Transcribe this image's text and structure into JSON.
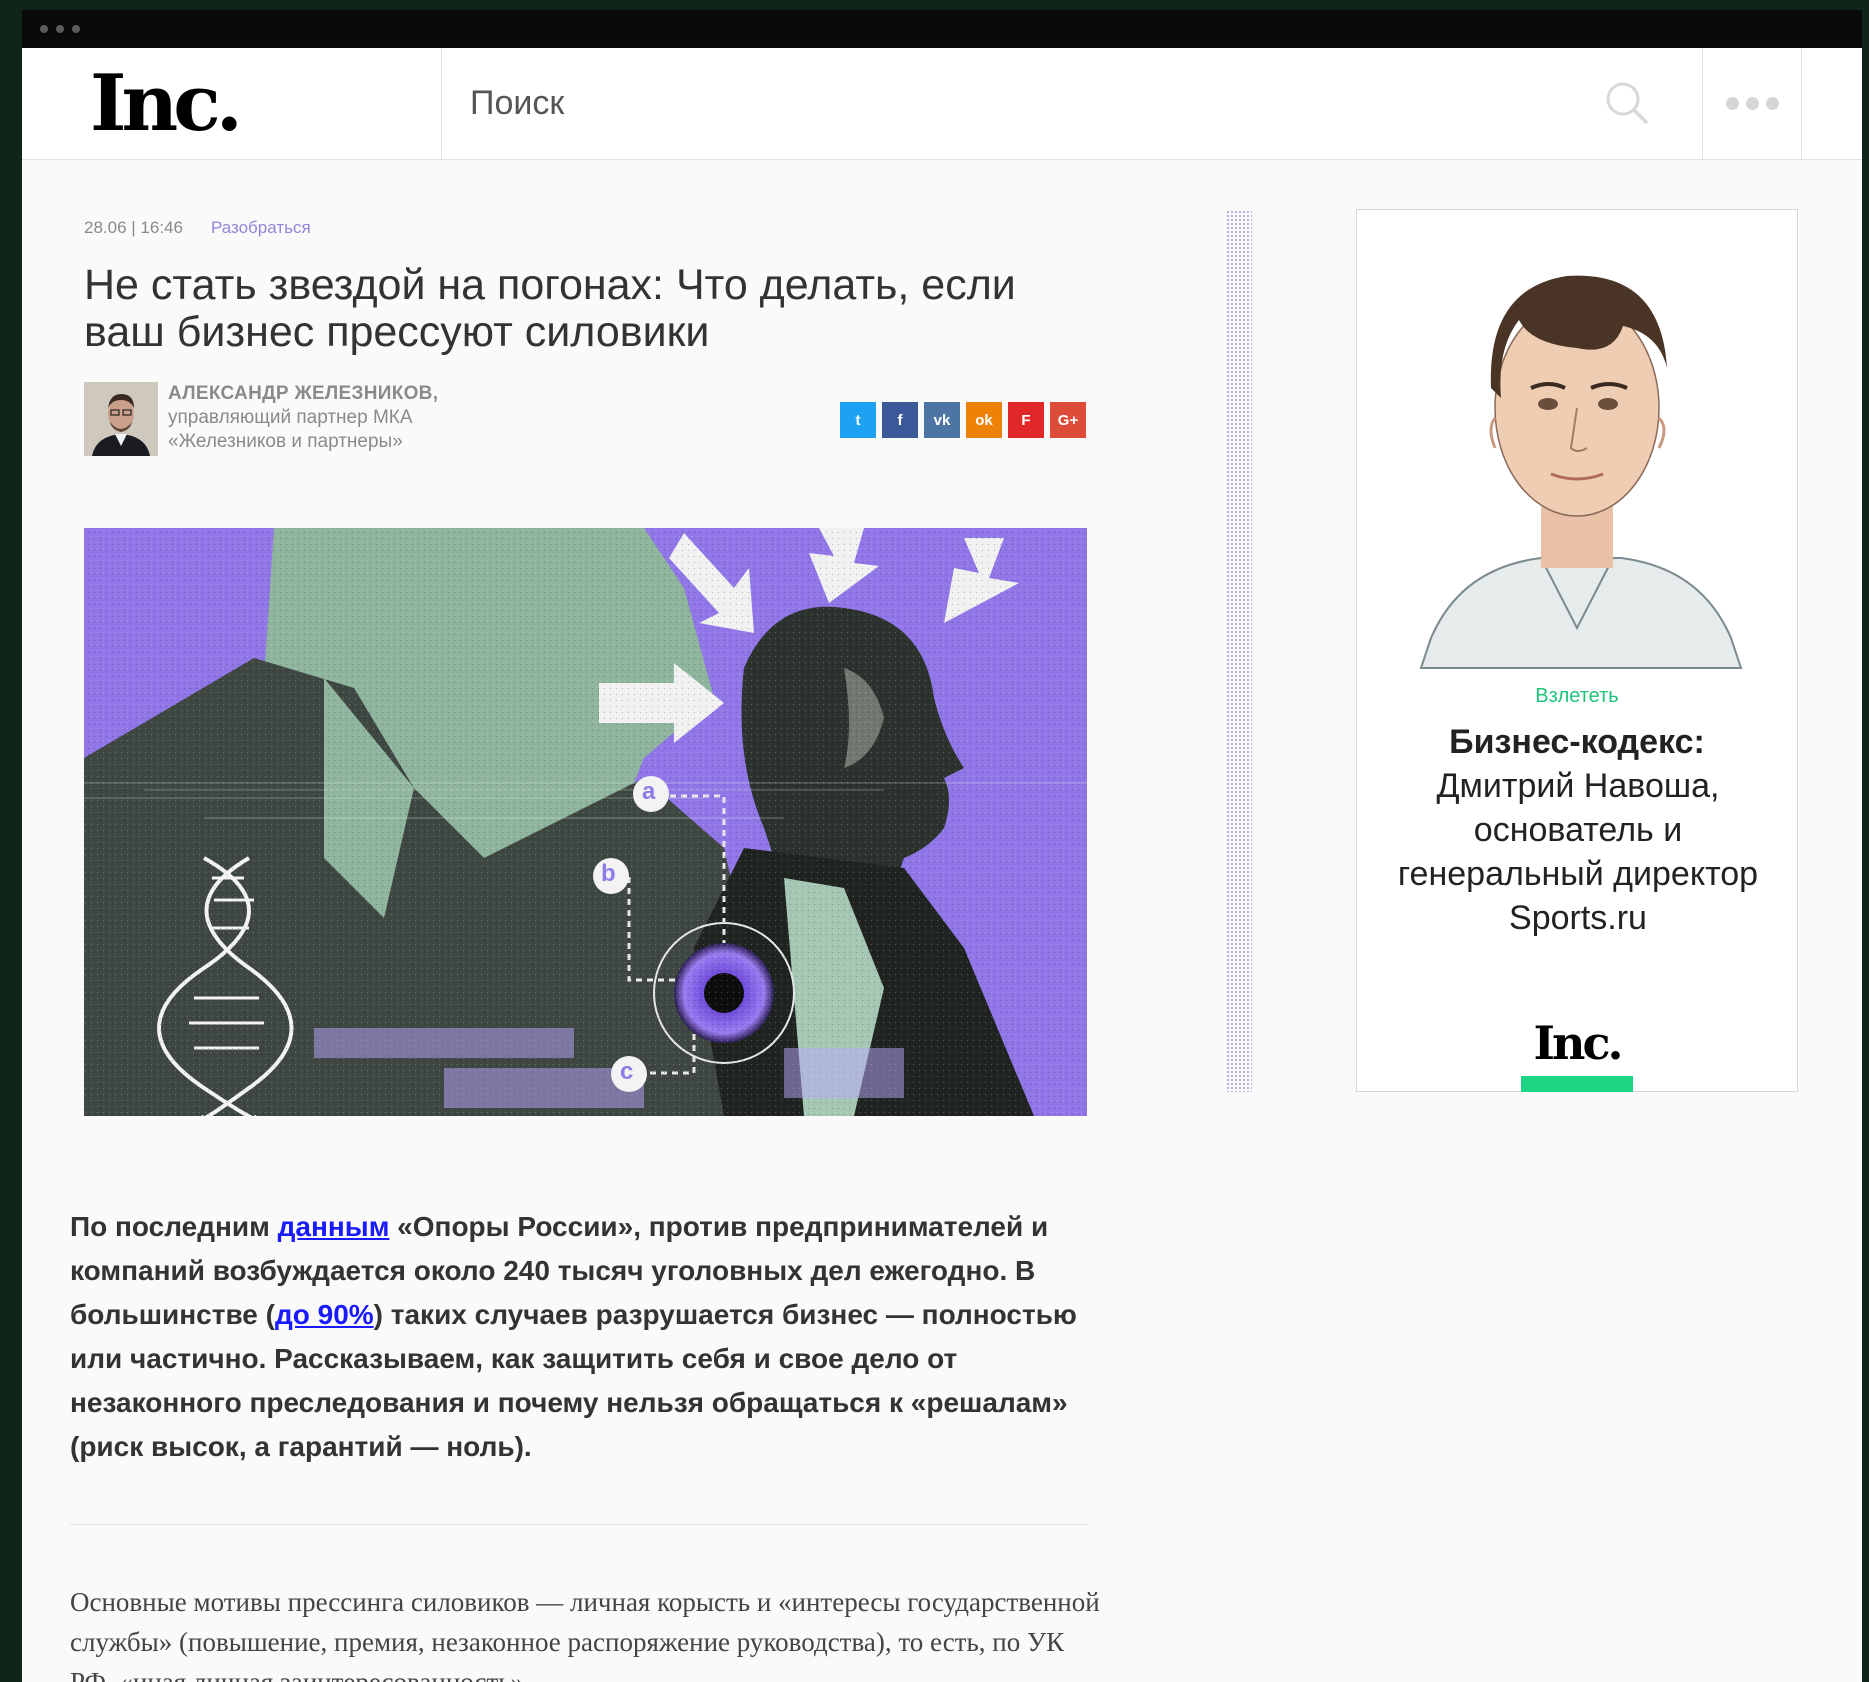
{
  "site": {
    "logo": "Inc."
  },
  "search": {
    "placeholder": "Поиск"
  },
  "article": {
    "date": "28.06 | 16:46",
    "rubric": "Разобраться",
    "title": "Не стать звездой на погонах: Что делать, если ваш бизнес прессуют силовики",
    "author_name": "АЛЕКСАНДР ЖЕЛЕЗНИКОВ,",
    "author_role_1": "управляющий партнер МКА",
    "author_role_2": "«Железников и партнеры»",
    "lead_1": "По последним ",
    "lead_link_1": "данным",
    "lead_2": " «Опоры России», против предпринимателей и компаний возбуждается около 240 тысяч уголовных дел ежегодно. В большинстве (",
    "lead_link_2": "до 90%",
    "lead_3": ") таких случаев разрушается бизнес — полностью или частично. Рассказываем, как защитить себя и свое дело от незаконного преследования и почему нельзя обращаться к «решалам» (риск высок, а гарантий — ноль).",
    "body": "Основные мотивы прессинга силовиков — личная корысть и «интересы государственной службы» (повышение, премия, незаконное распоряжение руководства), то есть, по УК РФ, «иная личная заинтересованность»."
  },
  "share": [
    {
      "icon": "twitter-icon",
      "glyph": "t",
      "color": "#1da1f2"
    },
    {
      "icon": "facebook-icon",
      "glyph": "f",
      "color": "#3b5998"
    },
    {
      "icon": "vk-icon",
      "glyph": "vk",
      "color": "#4c75a3"
    },
    {
      "icon": "odnoklassniki-icon",
      "glyph": "ok",
      "color": "#ee8208"
    },
    {
      "icon": "flipboard-icon",
      "glyph": "F",
      "color": "#e12828"
    },
    {
      "icon": "googleplus-icon",
      "glyph": "G+",
      "color": "#dd4b39"
    }
  ],
  "hero_labels": [
    "a",
    "b",
    "c"
  ],
  "ad": {
    "rubric": "Взлететь",
    "title": "Бизнес-кодекс:",
    "desc": "Дмитрий Навоша, основатель и генеральный директор Sports.ru",
    "logo": "Inc."
  }
}
